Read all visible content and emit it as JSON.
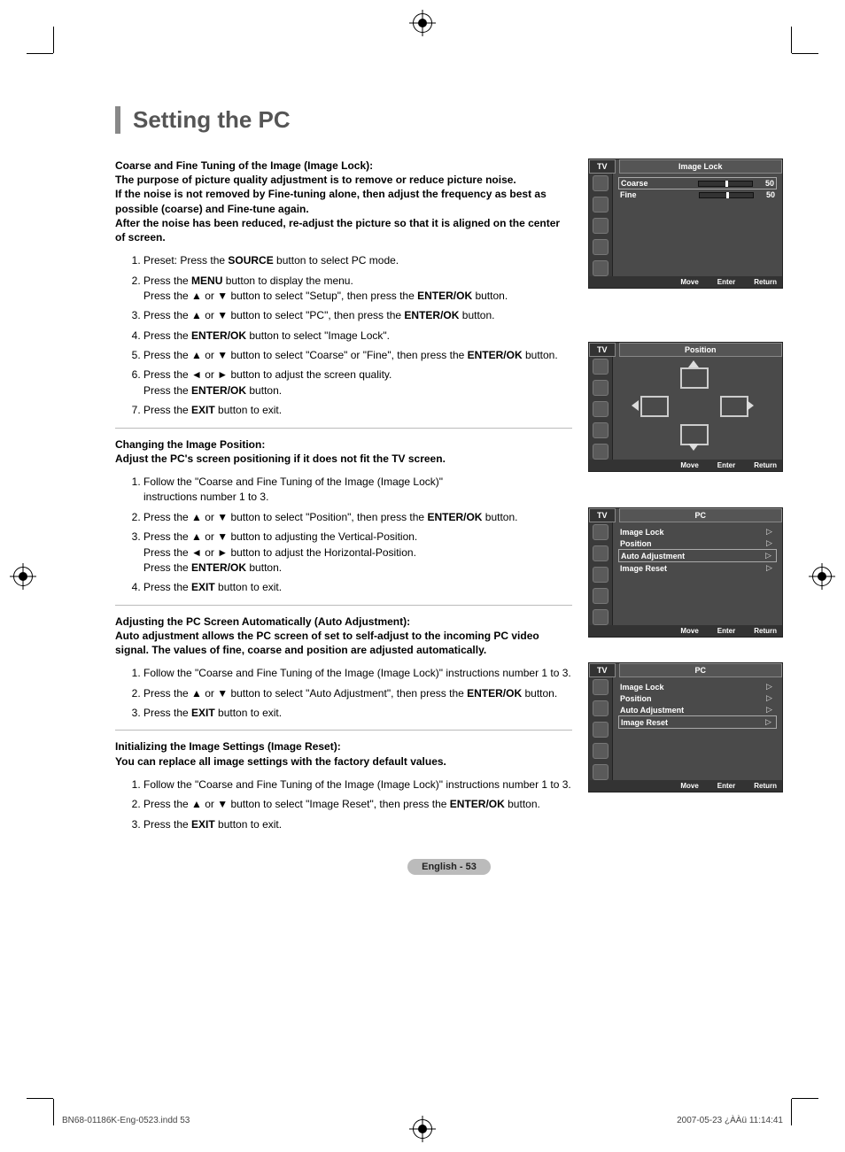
{
  "title": "Setting the PC",
  "section1": {
    "intro": "Coarse and Fine Tuning of the Image (Image Lock):\nThe purpose of picture quality adjustment is to remove or reduce picture noise.\nIf the noise is not removed by Fine-tuning alone, then adjust the frequency as best as possible (coarse) and Fine-tune again.\nAfter the noise has been reduced, re-adjust the picture so that it is aligned on the center of screen.",
    "steps": [
      "Preset: Press the <b>SOURCE</b> button to select PC mode.",
      "Press the <b>MENU</b> button to display the menu.<br>Press the ▲ or ▼ button to select \"Setup\", then press the <b>ENTER/OK</b> button.",
      "Press the ▲ or ▼ button to select \"PC\", then press the <b>ENTER/OK</b> button.",
      "Press the <b>ENTER/OK</b> button to select \"Image Lock\".",
      "Press the  ▲ or ▼ button to select \"Coarse\" or \"Fine\", then press the <b>ENTER/OK</b> button.",
      "Press the ◄ or ► button to adjust the screen quality.<br>Press the <b>ENTER/OK</b> button.",
      "Press the <b>EXIT</b> button to exit."
    ]
  },
  "section2": {
    "intro": "Changing the Image Position:\nAdjust the PC's screen positioning if it does not fit the TV screen.",
    "steps": [
      "Follow the \"Coarse and Fine Tuning of the Image (Image Lock)\"<br>instructions number 1 to 3.",
      "Press the ▲ or ▼ button to select \"Position\", then press the <b>ENTER/OK</b> button.",
      "Press the ▲ or ▼ button to adjusting the Vertical-Position.<br>Press the ◄ or ► button to adjust the Horizontal-Position.<br>Press the <b>ENTER/OK</b> button.",
      "Press the <b>EXIT</b> button to exit."
    ]
  },
  "section3": {
    "intro": "Adjusting the PC Screen Automatically (Auto Adjustment):\nAuto adjustment allows the PC screen of set to self-adjust to the incoming PC video signal. The values of fine, coarse and position are adjusted automatically.",
    "steps": [
      "Follow the \"Coarse and Fine Tuning of the Image (Image Lock)\"  instructions number 1 to 3.",
      "Press the ▲ or ▼ button to select \"Auto Adjustment\", then press the <b>ENTER/OK</b> button.",
      "Press the <b>EXIT</b> button to exit."
    ]
  },
  "section4": {
    "intro": "Initializing the Image Settings (Image Reset):\nYou can replace all image settings with the factory default values.",
    "steps": [
      "Follow the \"Coarse and Fine Tuning of the Image (Image Lock)\"  instructions number 1 to 3.",
      "Press the ▲ or ▼ button to select \"Image Reset\", then press the <b>ENTER/OK</b> button.",
      "Press the <b>EXIT</b> button to exit."
    ]
  },
  "osd1": {
    "tv": "TV",
    "title": "Image Lock",
    "rows": [
      {
        "label": "Coarse",
        "value": "50",
        "selected": true
      },
      {
        "label": "Fine",
        "value": "50",
        "selected": false
      }
    ],
    "foot": {
      "move": "Move",
      "enter": "Enter",
      "return": "Return"
    }
  },
  "osd2": {
    "tv": "TV",
    "title": "Position",
    "foot": {
      "move": "Move",
      "enter": "Enter",
      "return": "Return"
    }
  },
  "osd3": {
    "tv": "TV",
    "title": "PC",
    "rows": [
      {
        "label": "Image Lock",
        "selected": false
      },
      {
        "label": "Position",
        "selected": false
      },
      {
        "label": "Auto Adjustment",
        "selected": true
      },
      {
        "label": "Image Reset",
        "selected": false
      }
    ],
    "foot": {
      "move": "Move",
      "enter": "Enter",
      "return": "Return"
    }
  },
  "osd4": {
    "tv": "TV",
    "title": "PC",
    "rows": [
      {
        "label": "Image Lock",
        "selected": false
      },
      {
        "label": "Position",
        "selected": false
      },
      {
        "label": "Auto Adjustment",
        "selected": false
      },
      {
        "label": "Image Reset",
        "selected": true
      }
    ],
    "foot": {
      "move": "Move",
      "enter": "Enter",
      "return": "Return"
    }
  },
  "pageNum": "English - 53",
  "imprint": {
    "left": "BN68-01186K-Eng-0523.indd   53",
    "right": "2007-05-23   ¿ÀÀü 11:14:41"
  }
}
